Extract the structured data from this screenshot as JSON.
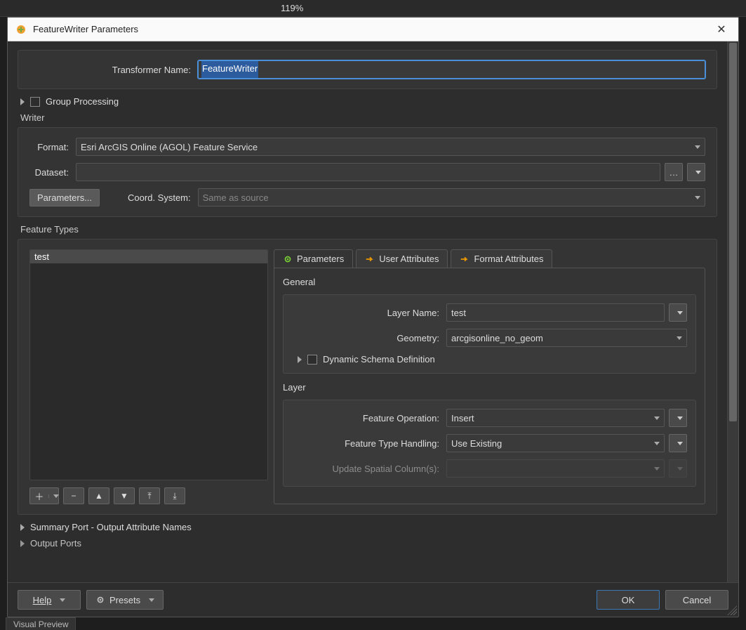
{
  "toolbar": {
    "zoom": "119%"
  },
  "window": {
    "title": "FeatureWriter Parameters"
  },
  "transformer": {
    "name_label": "Transformer Name:",
    "name_value": "FeatureWriter"
  },
  "group_processing": {
    "label": "Group Processing"
  },
  "writer": {
    "section": "Writer",
    "format_label": "Format:",
    "format_value": "Esri ArcGIS Online (AGOL) Feature Service",
    "dataset_label": "Dataset:",
    "dataset_value": "",
    "parameters_btn": "Parameters...",
    "coord_label": "Coord. System:",
    "coord_placeholder": "Same as source"
  },
  "feature_types": {
    "section": "Feature Types",
    "items": [
      "test"
    ],
    "tabs": {
      "parameters": "Parameters",
      "user_attrs": "User Attributes",
      "format_attrs": "Format Attributes"
    },
    "general": {
      "heading": "General",
      "layer_name_label": "Layer Name:",
      "layer_name_value": "test",
      "geometry_label": "Geometry:",
      "geometry_value": "arcgisonline_no_geom",
      "dynamic_label": "Dynamic Schema Definition"
    },
    "layer": {
      "heading": "Layer",
      "feature_op_label": "Feature Operation:",
      "feature_op_value": "Insert",
      "handling_label": "Feature Type Handling:",
      "handling_value": "Use Existing",
      "update_spatial_label": "Update Spatial Column(s):",
      "update_spatial_value": ""
    }
  },
  "summary_port": {
    "label": "Summary Port - Output Attribute Names"
  },
  "output_ports": {
    "label": "Output Ports"
  },
  "footer": {
    "help": "Help",
    "presets": "Presets",
    "ok": "OK",
    "cancel": "Cancel"
  },
  "bottom_tab": "Visual Preview"
}
